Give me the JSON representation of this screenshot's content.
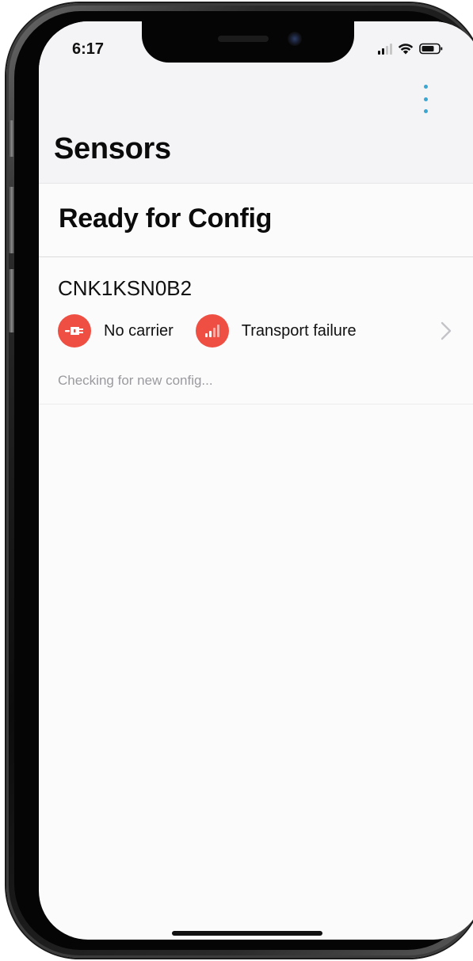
{
  "status_bar": {
    "time": "6:17",
    "icons": [
      "cellular-signal-icon",
      "wifi-icon",
      "battery-icon"
    ]
  },
  "nav": {
    "title": "Sensors",
    "menu_icon": "more-vertical-icon",
    "accent_color": "#3aa6d2"
  },
  "section": {
    "title": "Ready for Config"
  },
  "sensors": [
    {
      "id": "CNK1KSN0B2",
      "statuses": [
        {
          "icon": "ethernet-plug-icon",
          "label": "No carrier",
          "color": "#ef4f43"
        },
        {
          "icon": "signal-bars-icon",
          "label": "Transport failure",
          "color": "#ef4f43"
        }
      ],
      "config_status": "Checking for new config..."
    }
  ]
}
